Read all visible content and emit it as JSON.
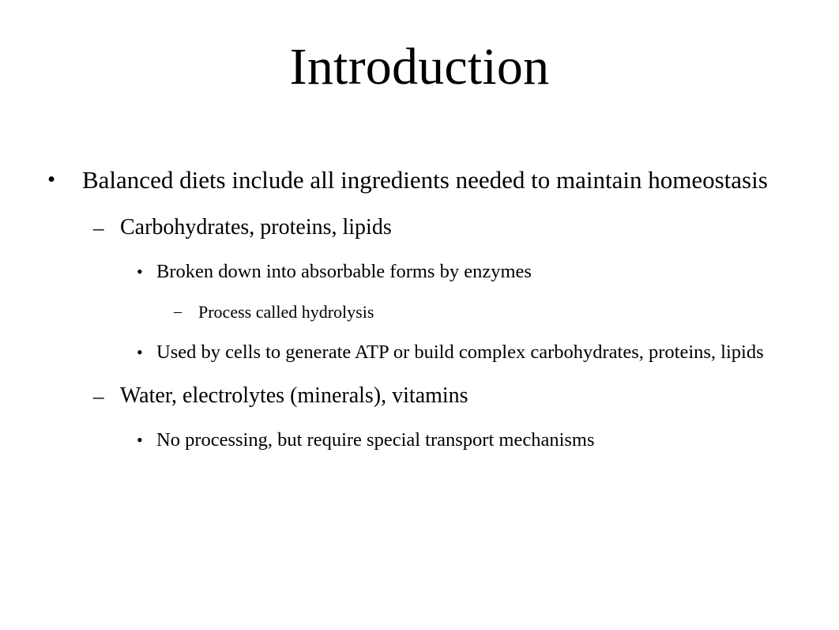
{
  "slide": {
    "title": "Introduction",
    "background_color": "#ffffff",
    "text_color": "#000000",
    "markers": {
      "level1": "•",
      "level2": "–",
      "level3": "•",
      "level4": "–"
    },
    "outline": [
      {
        "level": 1,
        "marker": "•",
        "text": "Balanced diets include all ingredients needed to maintain homeostasis"
      },
      {
        "level": 2,
        "marker": "–",
        "text": "Carbohydrates, proteins, lipids"
      },
      {
        "level": 3,
        "marker": "•",
        "text": "Broken down into absorbable forms by enzymes"
      },
      {
        "level": 4,
        "marker": "–",
        "text": "Process called hydrolysis"
      },
      {
        "level": 3,
        "marker": "•",
        "text": "Used by cells to generate ATP or build complex carbohydrates, proteins, lipids"
      },
      {
        "level": 2,
        "marker": "–",
        "text": "Water, electrolytes (minerals), vitamins"
      },
      {
        "level": 3,
        "marker": "•",
        "text": "No processing, but require special transport mechanisms"
      }
    ]
  }
}
